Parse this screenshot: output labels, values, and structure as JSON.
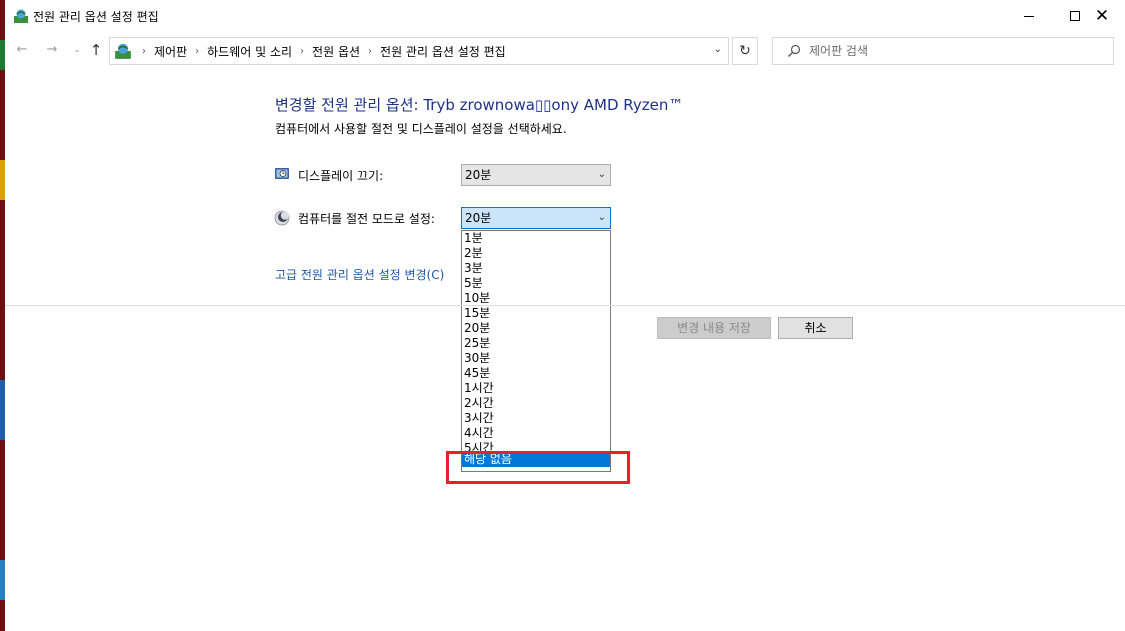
{
  "window": {
    "title": "전원 관리 옵션 설정 편집"
  },
  "nav": {
    "breadcrumbs": [
      "제어판",
      "하드웨어 및 소리",
      "전원 옵션",
      "전원 관리 옵션 설정 편집"
    ],
    "search_placeholder": "제어판 검색"
  },
  "main": {
    "heading": "변경할 전원 관리 옵션: Tryb zrownowa▯▯ony AMD Ryzen™",
    "subtext": "컴퓨터에서 사용할 절전 및 디스플레이 설정을 선택하세요.",
    "display_off": {
      "label": "디스플레이 끄기:",
      "value": "20분"
    },
    "sleep": {
      "label": "컴퓨터를 절전 모드로 설정:",
      "value": "20분",
      "options": [
        "1분",
        "2분",
        "3분",
        "5분",
        "10분",
        "15분",
        "20분",
        "25분",
        "30분",
        "45분",
        "1시간",
        "2시간",
        "3시간",
        "4시간",
        "5시간",
        "해당 없음"
      ],
      "highlighted_option": "해당 없음"
    },
    "advanced_link": "고급 전원 관리 옵션 설정 변경(C)",
    "save_button": "변경 내용 저장",
    "cancel_button": "취소"
  },
  "colors": {
    "heading": "#1e3287",
    "link": "#1e5aa8",
    "selection": "#0078d7",
    "annotation": "#e8202a"
  }
}
